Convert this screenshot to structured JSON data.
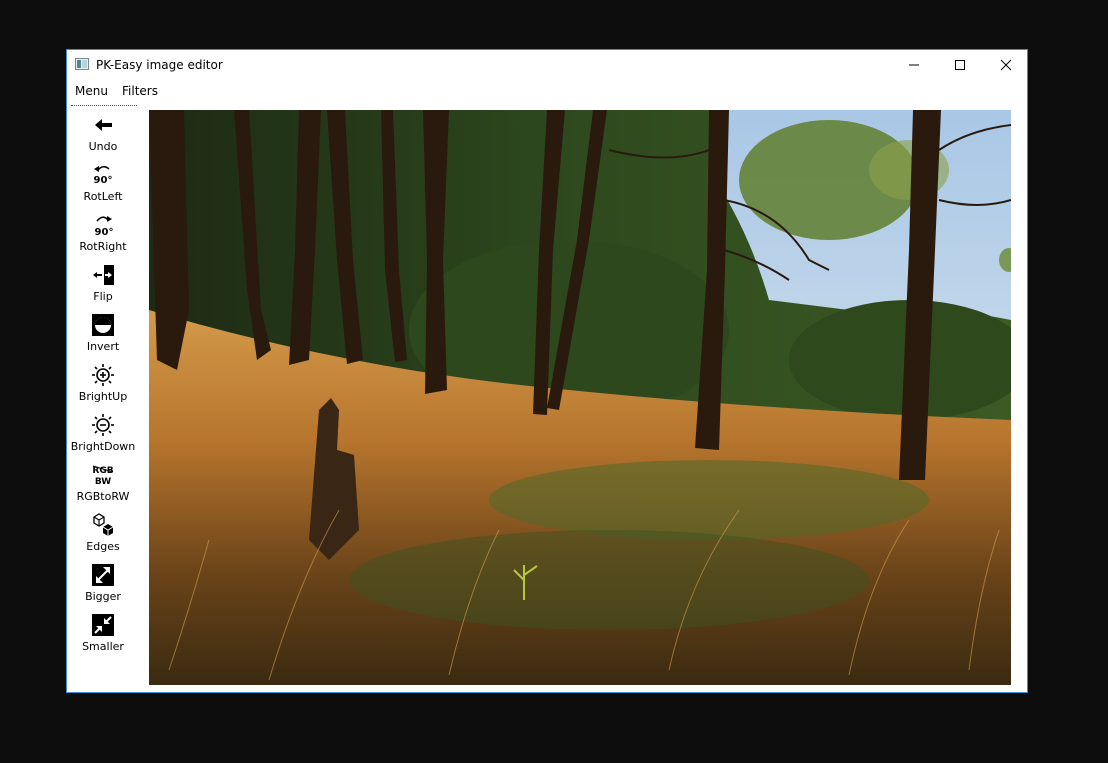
{
  "window": {
    "title": "PK-Easy image editor",
    "controls": [
      "minimize-icon",
      "maximize-icon",
      "close-icon"
    ]
  },
  "menu": {
    "items": [
      {
        "label": "Menu"
      },
      {
        "label": "Filters"
      }
    ]
  },
  "toolbar": {
    "tools": [
      {
        "label": "Undo",
        "icon": "undo-arrow-icon"
      },
      {
        "label": "RotLeft",
        "icon": "rotate-left-90-icon",
        "icon_text": "90°"
      },
      {
        "label": "RotRight",
        "icon": "rotate-right-90-icon",
        "icon_text": "90°"
      },
      {
        "label": "Flip",
        "icon": "flip-icon"
      },
      {
        "label": "Invert",
        "icon": "invert-icon"
      },
      {
        "label": "BrightUp",
        "icon": "brightness-up-icon"
      },
      {
        "label": "BrightDown",
        "icon": "brightness-down-icon"
      },
      {
        "label": "RGBtoRW",
        "icon": "rgb-to-bw-icon",
        "icon_text_top": "RGB",
        "icon_text_bottom": "BW"
      },
      {
        "label": "Edges",
        "icon": "edges-icon"
      },
      {
        "label": "Bigger",
        "icon": "enlarge-icon"
      },
      {
        "label": "Smaller",
        "icon": "shrink-icon"
      }
    ]
  },
  "image": {
    "subject": "forest-meadow-photo"
  },
  "colors": {
    "window_border": "#3c8fd6",
    "background": "#0d0d0e",
    "window_bg": "#ffffff"
  }
}
